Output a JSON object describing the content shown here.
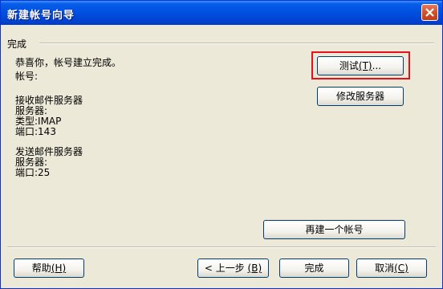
{
  "window": {
    "title": "新建帐号向导"
  },
  "group": {
    "legend": "完成"
  },
  "info": {
    "congrats": "恭喜你，帐号建立完成。",
    "account": "帐号:",
    "incoming_header": "接收邮件服务器",
    "incoming_server": "服务器:",
    "incoming_type": "类型:IMAP",
    "incoming_port": "端口:143",
    "outgoing_header": "发送邮件服务器",
    "outgoing_server": "服务器:",
    "outgoing_port": "端口:25"
  },
  "buttons": {
    "test": {
      "text": "测试",
      "key": "(T)",
      "suffix": "..."
    },
    "modify_server": "修改服务器",
    "new_account": "再建一个帐号",
    "help": {
      "text": "帮助",
      "key": "(H)"
    },
    "back": {
      "prefix": "< 上一步 ",
      "key": "(B)"
    },
    "finish": "完成",
    "cancel": {
      "text": "取消",
      "key": "(C)"
    }
  },
  "colors": {
    "highlight": "#e8101b",
    "titlebar": "#0055e5"
  },
  "icons": {
    "close": "close-x-icon"
  }
}
